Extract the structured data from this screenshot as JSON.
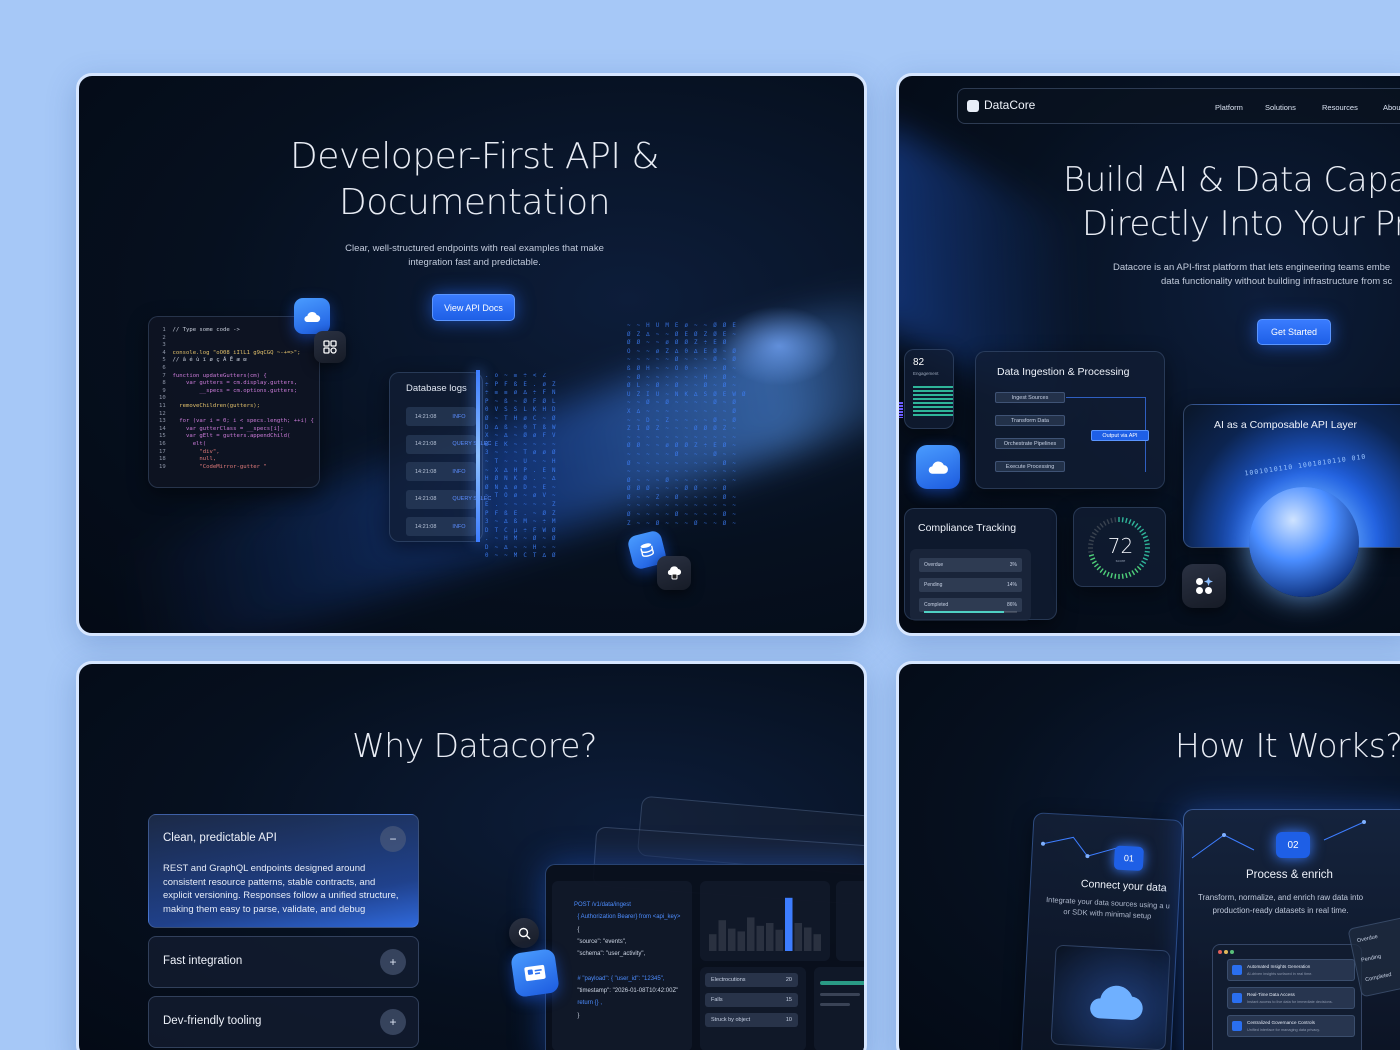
{
  "panel1": {
    "title": "Developer-First API & Documentation",
    "title_line1": "Developer-First API &",
    "title_line2": "Documentation",
    "subtitle_line1": "Clear, well-structured endpoints with real examples that make",
    "subtitle_line2": "integration fast and predictable.",
    "button": "View API Docs",
    "code_lines": [
      {
        "n": "1",
        "t": "// Type some code ->",
        "c": "#c7cdd9"
      },
      {
        "n": "2",
        "t": "",
        "c": "#c7cdd9"
      },
      {
        "n": "3",
        "t": "",
        "c": "#c7cdd9"
      },
      {
        "n": "4",
        "t": "console.log \"oO08 iIlL1 g9qCGQ ~-+=>\";",
        "c": "#e2c16b"
      },
      {
        "n": "5",
        "t": "// â é ù ï ø ç Ã Ē æ œ",
        "c": "#c7cdd9"
      },
      {
        "n": "6",
        "t": "",
        "c": "#c7cdd9"
      },
      {
        "n": "7",
        "t": "function updateGutters(cm) {",
        "c": "#cc7bd9"
      },
      {
        "n": "8",
        "t": "    var gutters = cm.display.gutters,",
        "c": "#cc7bd9"
      },
      {
        "n": "9",
        "t": "        __specs = cm.options.gutters;",
        "c": "#cc7bd9"
      },
      {
        "n": "10",
        "t": "",
        "c": "#c7cdd9"
      },
      {
        "n": "11",
        "t": "  removeChildren(gutters);",
        "c": "#e2c16b"
      },
      {
        "n": "12",
        "t": "",
        "c": "#c7cdd9"
      },
      {
        "n": "13",
        "t": "  for (var i = 0; i < specs.length; ++i) {",
        "c": "#cc7bd9"
      },
      {
        "n": "14",
        "t": "    var gutterClass = __specs[i];",
        "c": "#cc7bd9"
      },
      {
        "n": "15",
        "t": "    var gElt = gutters.appendChild(",
        "c": "#cc7bd9"
      },
      {
        "n": "16",
        "t": "      elt(",
        "c": "#cc7bd9"
      },
      {
        "n": "17",
        "t": "        \"div\",",
        "c": "#e07a7a"
      },
      {
        "n": "18",
        "t": "        null,",
        "c": "#e07a7a"
      },
      {
        "n": "19",
        "t": "        \"CodeMirror-gutter \"",
        "c": "#e07a7a"
      }
    ],
    "db_title": "Database logs",
    "logs": [
      {
        "time": "14:21:08",
        "level": "INFO"
      },
      {
        "time": "14:21:08",
        "level": "QUERY SELEC"
      },
      {
        "time": "14:21:08",
        "level": "INFO"
      },
      {
        "time": "14:21:08",
        "level": "QUERY SELEC"
      },
      {
        "time": "14:21:08",
        "level": "INFO"
      }
    ]
  },
  "panel2": {
    "logo": "DataCore",
    "nav": [
      "Platform",
      "Solutions",
      "Resources",
      "About"
    ],
    "title_line1": "Build AI & Data Capa",
    "title_line2": "Directly Into Your Pr",
    "subtitle_line1": "Datacore is an API-first platform that lets engineering teams embe",
    "subtitle_line2": "data functionality without building infrastructure from sc",
    "button": "Get Started",
    "engagement_value": "82",
    "engagement_label": "Engagement",
    "ingestion_title": "Data Ingestion & Processing",
    "steps": [
      "Ingest Sources",
      "Transform Data",
      "Orchestrate Pipelines",
      "Execute Processing"
    ],
    "output": "Output via API",
    "ai_title": "AI as a Composable API Layer",
    "compliance_title": "Compliance Tracking",
    "compliance": [
      {
        "label": "Overdue",
        "value": "3%"
      },
      {
        "label": "Pending",
        "value": "14%"
      },
      {
        "label": "Completed",
        "value": "86%",
        "fill": 0.86
      }
    ],
    "score": "72",
    "score_label": "score",
    "score_fraction": 0.72
  },
  "panel3": {
    "title": "Why Datacore?",
    "items": [
      {
        "title": "Clean, predictable API",
        "toggle": "−",
        "body_lines": [
          "REST and GraphQL endpoints designed around",
          "consistent resource patterns, stable contracts, and",
          "explicit versioning. Responses follow a unified structure,",
          "making them easy to parse, validate, and debug"
        ]
      },
      {
        "title": "Fast integration",
        "toggle": "+"
      },
      {
        "title": "Dev-friendly tooling",
        "toggle": "+"
      }
    ],
    "code_lines": [
      {
        "t": "POST /v1/data/ingest",
        "c": "#4d8dff"
      },
      {
        "t": "  { Authorization Bearer} from <api_key>",
        "c": "#4d8dff"
      },
      {
        "t": "  {",
        "c": "#cfd7e6"
      },
      {
        "t": "  \"source\": \"events\",",
        "c": "#cfd7e6"
      },
      {
        "t": "  \"schema\": \"user_activity\",",
        "c": "#cfd7e6"
      },
      {
        "t": "",
        "c": "#cfd7e6"
      },
      {
        "t": "  # \"payload\": { \"user_id\": \"12345\",",
        "c": "#4d8dff"
      },
      {
        "t": "  \"timestamp\": \"2026-01-08T10:42:00Z\"",
        "c": "#cfd7e6"
      },
      {
        "t": "  return {} ,",
        "c": "#4d8dff"
      },
      {
        "t": "  }",
        "c": "#cfd7e6"
      }
    ],
    "bars": [
      0.3,
      0.55,
      0.4,
      0.35,
      0.6,
      0.45,
      0.5,
      0.38,
      0.95,
      0.5,
      0.42,
      0.3
    ],
    "metrics": [
      {
        "label": "Electrocutions",
        "value": "20"
      },
      {
        "label": "Falls",
        "value": "15"
      },
      {
        "label": "Struck by object",
        "value": "10"
      }
    ]
  },
  "panel4": {
    "title": "How It Works?",
    "step1": {
      "num": "01",
      "title": "Connect your data",
      "desc_line1": "Integrate your data sources using a u",
      "desc_line2": "or SDK with minimal setup"
    },
    "step2": {
      "num": "02",
      "title": "Process & enrich",
      "desc_line1": "Transform, normalize, and enrich raw data into",
      "desc_line2": "production-ready datasets in real time."
    },
    "list": [
      {
        "title": "Automated Insights Generation",
        "desc": "AI-driven insights surfaced in real time."
      },
      {
        "title": "Real-Time Data Access",
        "desc": "Instant access to live data for immediate decisions."
      },
      {
        "title": "Centralized Governance Controls",
        "desc": "Unified interface for managing data privacy."
      }
    ],
    "side_labels": [
      "Overdue",
      "Pending",
      "Completed"
    ]
  }
}
